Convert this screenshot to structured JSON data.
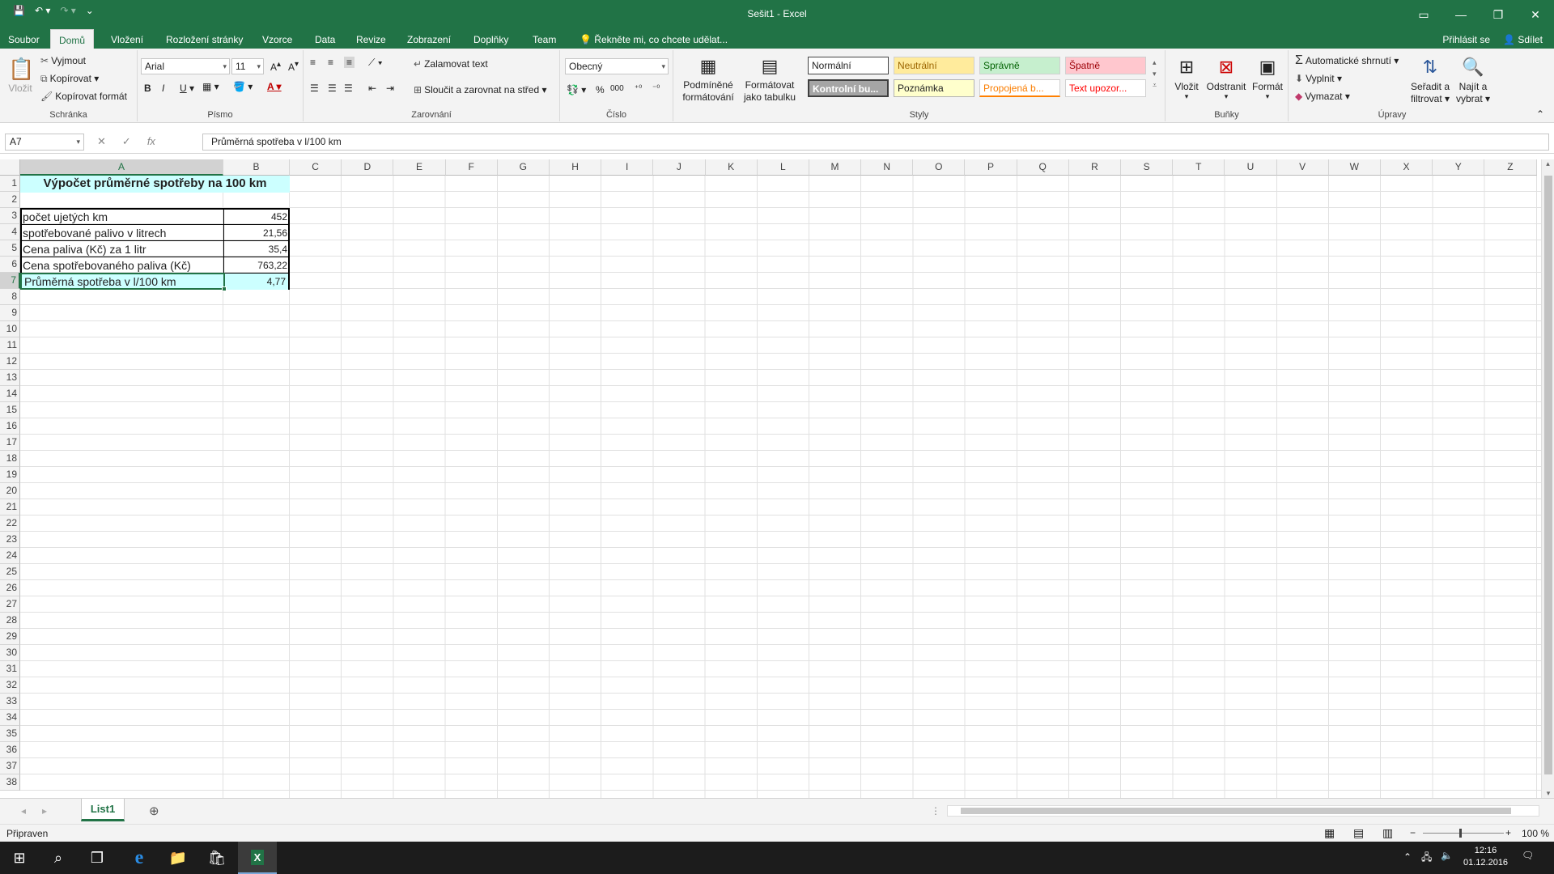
{
  "window": {
    "title": "Sešit1 - Excel"
  },
  "ribbon_tabs": [
    "Soubor",
    "Domů",
    "Vložení",
    "Rozložení stránky",
    "Vzorce",
    "Data",
    "Revize",
    "Zobrazení",
    "Doplňky",
    "Team"
  ],
  "tell_me": "Řekněte mi, co chcete udělat...",
  "account": {
    "signin": "Přihlásit se",
    "share": "Sdílet"
  },
  "clipboard": {
    "paste": "Vložit",
    "cut": "Vyjmout",
    "copy": "Kopírovat",
    "format_painter": "Kopírovat formát",
    "label": "Schránka"
  },
  "font": {
    "name": "Arial",
    "size": "11",
    "label": "Písmo",
    "bold": "B",
    "italic": "I",
    "underline": "U"
  },
  "alignment": {
    "wrap": "Zalamovat text",
    "merge": "Sloučit a zarovnat na střed",
    "label": "Zarovnání"
  },
  "number": {
    "format": "Obecný",
    "label": "Číslo"
  },
  "styles": {
    "conditional_1": "Podmíněné",
    "conditional_2": "formátování",
    "as_table_1": "Formátovat",
    "as_table_2": "jako tabulku",
    "label": "Styly",
    "normal": "Normální",
    "neutral": "Neutrální",
    "good": "Správně",
    "bad": "Špatně",
    "check": "Kontrolní bu...",
    "note": "Poznámka",
    "linked": "Propojená b...",
    "warning": "Text upozor..."
  },
  "cells_group": {
    "insert": "Vložit",
    "delete": "Odstranit",
    "format": "Formát",
    "label": "Buňky"
  },
  "editing": {
    "autosum": "Automatické shrnutí",
    "fill": "Vyplnit",
    "clear": "Vymazat",
    "sort_1": "Seřadit a",
    "sort_2": "filtrovat",
    "find_1": "Najít a",
    "find_2": "vybrat",
    "label": "Úpravy"
  },
  "formula_bar": {
    "name_box": "A7",
    "fx": "fx",
    "content": "Průměrná spotřeba v l/100 km"
  },
  "columns": [
    "A",
    "B",
    "C",
    "D",
    "E",
    "F",
    "G",
    "H",
    "I",
    "J",
    "K",
    "L",
    "M",
    "N",
    "O",
    "P",
    "Q",
    "R",
    "S",
    "T",
    "U",
    "V",
    "W",
    "X",
    "Y",
    "Z"
  ],
  "rows": [
    "1",
    "2",
    "3",
    "4",
    "5",
    "6",
    "7",
    "8",
    "9",
    "10",
    "11",
    "12",
    "13",
    "14",
    "15",
    "16",
    "17",
    "18",
    "19",
    "20",
    "21",
    "22",
    "23",
    "24",
    "25",
    "26",
    "27",
    "28",
    "29",
    "30",
    "31",
    "32",
    "33",
    "34",
    "35",
    "36",
    "37",
    "38"
  ],
  "sheet": {
    "title": "Výpočet průměrné spotřeby na 100 km",
    "rows": [
      {
        "label": "počet ujetých km",
        "value": "452"
      },
      {
        "label": "spotřebované palivo v litrech",
        "value": "21,56"
      },
      {
        "label": "Cena paliva (Kč) za 1 litr",
        "value": "35,4"
      },
      {
        "label": "Cena spotřebovaného paliva (Kč)",
        "value": "763,22"
      },
      {
        "label": "Průměrná spotřeba v l/100 km",
        "value": "4,77"
      }
    ]
  },
  "sheet_tabs": [
    "List1"
  ],
  "status": {
    "ready": "Připraven",
    "zoom": "100 %"
  },
  "taskbar": {
    "time": "12:16",
    "date": "01.12.2016"
  },
  "colors": {
    "excel_green": "#217346",
    "title_fill": "#ccffff",
    "selected_fill": "#ccffff"
  }
}
